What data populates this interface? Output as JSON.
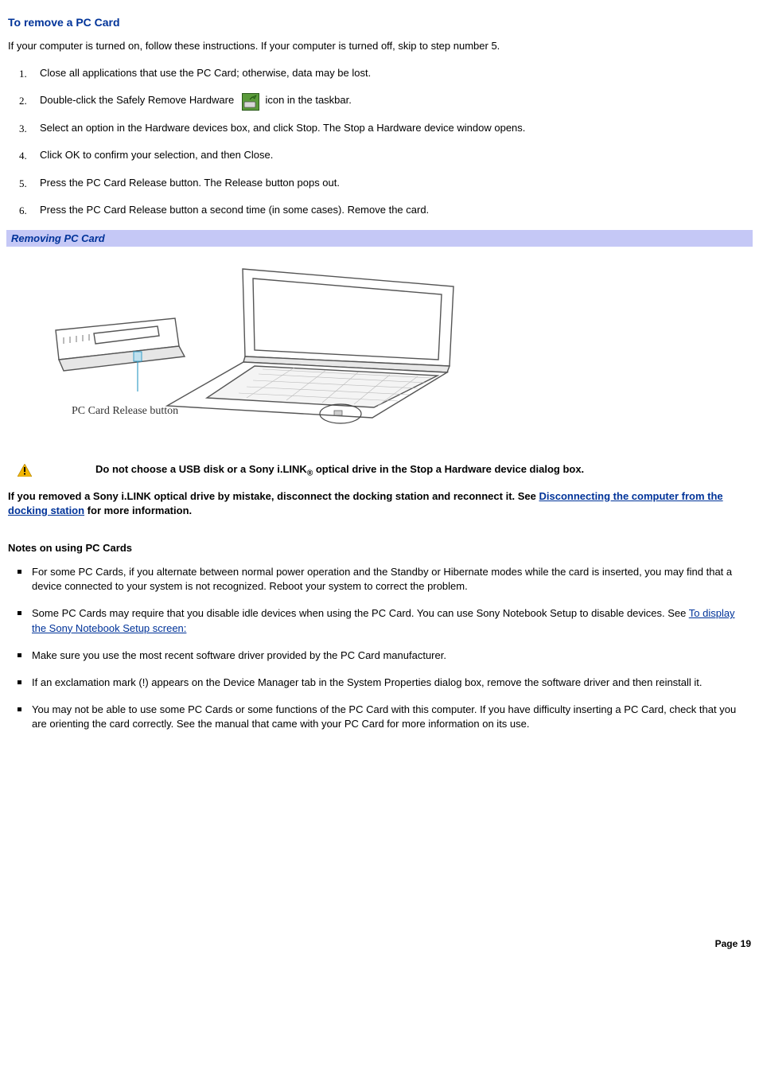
{
  "title": "To remove a PC Card",
  "intro": "If your computer is turned on, follow these instructions. If your computer is turned off, skip to step number 5.",
  "steps": [
    "Close all applications that use the PC Card; otherwise, data may be lost.",
    {
      "pre": "Double-click the Safely Remove Hardware ",
      "post": " icon in the taskbar."
    },
    "Select an option in the Hardware devices box, and click Stop. The Stop a Hardware device window opens.",
    "Click OK to confirm your selection, and then Close.",
    "Press the PC Card Release button. The Release button pops out.",
    "Press the PC Card Release button a second time (in some cases). Remove the card."
  ],
  "figure_caption": "Removing PC Card",
  "figure_label": "PC Card Release button",
  "warning": {
    "pre": "Do not choose a USB disk or a Sony i.LINK",
    "sub": "®",
    "post": " optical drive in the Stop a Hardware device dialog box."
  },
  "bold_paragraph": {
    "pre": "If you removed a Sony i.LINK optical drive by mistake, disconnect the docking station and reconnect it. See ",
    "link": "Disconnecting the computer from the docking station",
    "post": " for more information."
  },
  "notes_heading": "Notes on using PC Cards",
  "notes": [
    "For some PC Cards, if you alternate between normal power operation and the Standby or Hibernate modes while the card is inserted, you may find that a device connected to your system is not recognized. Reboot your system to correct the problem.",
    {
      "pre": "Some PC Cards may require that you disable idle devices when using the PC Card. You can use Sony Notebook Setup to disable devices. See ",
      "link": "To display the Sony Notebook Setup screen:"
    },
    "Make sure you use the most recent software driver provided by the PC Card manufacturer.",
    "If an exclamation mark (!) appears on the Device Manager tab in the System Properties dialog box, remove the software driver and then reinstall it.",
    "You may not be able to use some PC Cards or some functions of the PC Card with this computer. If you have difficulty inserting a PC Card, check that you are orienting the card correctly. See the manual that came with your PC Card for more information on its use."
  ],
  "page_footer": "Page 19"
}
